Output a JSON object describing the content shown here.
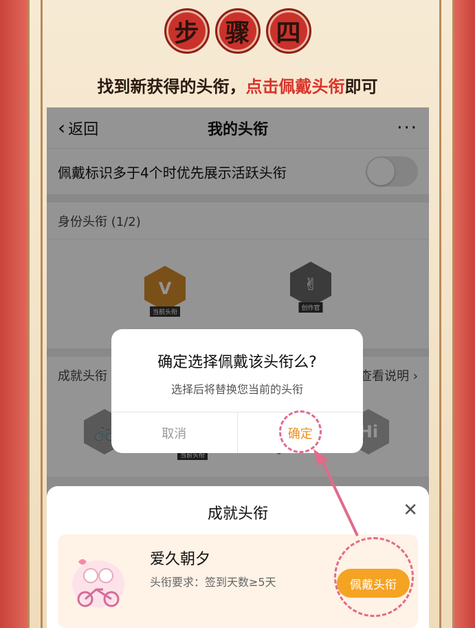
{
  "step": {
    "chars": [
      "步",
      "骤",
      "四"
    ]
  },
  "headline": {
    "main": "找到新获得的头衔，",
    "highlight": "点击佩戴头衔",
    "tail": "即可"
  },
  "nav": {
    "back_label": "返回",
    "title": "我的头衔",
    "more": "···"
  },
  "setting": {
    "label": "佩戴标识多于4个时优先展示活跃头衔",
    "toggle_on": false
  },
  "identity_section": {
    "title": "身份头衔 (1/2)",
    "badges": [
      {
        "tag": "当前头衔",
        "icon": "vip-badge-icon"
      },
      {
        "tag": "创作官",
        "icon": "creator-badge-icon"
      }
    ]
  },
  "achievement_section": {
    "title": "成就头衔",
    "link": "查看说明",
    "badges": [
      {
        "tag": "当前头衔"
      }
    ]
  },
  "dialog": {
    "title": "确定选择佩戴该头衔么?",
    "subtitle": "选择后将替换您当前的头衔",
    "cancel_label": "取消",
    "ok_label": "确定"
  },
  "sheet": {
    "title": "成就头衔",
    "close_icon": "close-icon",
    "card": {
      "name": "爱久朝夕",
      "requirement": "头衔要求：签到天数≥5天",
      "button_label": "佩戴头衔"
    }
  },
  "colors": {
    "accent": "#f5a323",
    "highlight": "#d9342a",
    "frame_red": "#c9433a",
    "dash": "#e26a8a"
  }
}
